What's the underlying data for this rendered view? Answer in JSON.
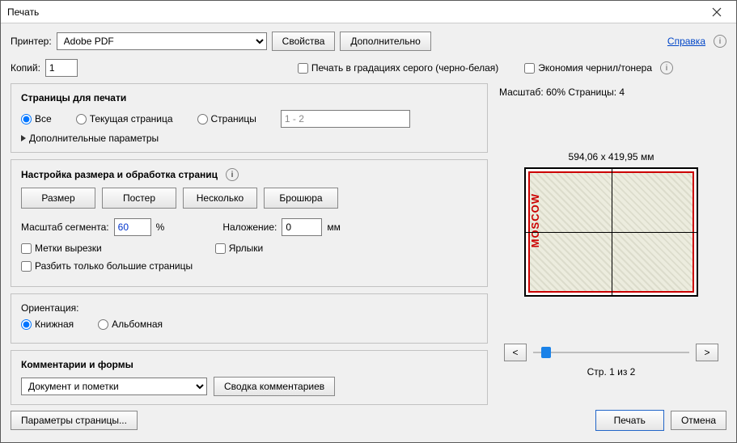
{
  "title": "Печать",
  "top": {
    "printer_label": "Принтер:",
    "printer_value": "Adobe PDF",
    "properties_btn": "Свойства",
    "advanced_btn": "Дополнительно",
    "help_link": "Справка"
  },
  "copies": {
    "label": "Копий:",
    "value": "1",
    "grayscale": "Печать в градациях серого (черно-белая)",
    "save_ink": "Экономия чернил/тонера"
  },
  "pages_panel": {
    "title": "Страницы для печати",
    "all": "Все",
    "current": "Текущая страница",
    "range": "Страницы",
    "range_value": "1 - 2",
    "more": "Дополнительные параметры"
  },
  "sizing_panel": {
    "title": "Настройка размера и обработка страниц",
    "tabs": {
      "size": "Размер",
      "poster": "Постер",
      "multiple": "Несколько",
      "booklet": "Брошюра"
    },
    "scale_label": "Масштаб сегмента:",
    "scale_value": "60",
    "percent": "%",
    "overlap_label": "Наложение:",
    "overlap_value": "0",
    "overlap_unit": "мм",
    "cut_marks": "Метки вырезки",
    "labels": "Ярлыки",
    "split_large": "Разбить только большие страницы"
  },
  "orientation_panel": {
    "title": "Ориентация:",
    "portrait": "Книжная",
    "landscape": "Альбомная"
  },
  "comments_panel": {
    "title": "Комментарии и формы",
    "value": "Документ и пометки",
    "summary_btn": "Сводка комментариев"
  },
  "preview": {
    "scale_info": "Масштаб:  60% Страницы: 4",
    "dimensions": "594,06 x 419,95 мм",
    "moscow": "MOSCOW",
    "prev": "<",
    "next": ">",
    "page_indicator": "Стр. 1 из 2"
  },
  "bottom": {
    "page_setup": "Параметры страницы...",
    "print": "Печать",
    "cancel": "Отмена"
  }
}
